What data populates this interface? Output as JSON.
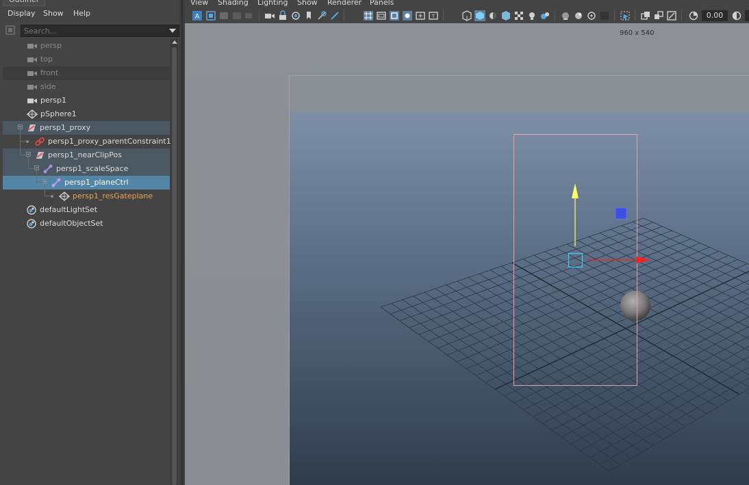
{
  "outliner": {
    "title": "Outliner",
    "menus": [
      "Display",
      "Show",
      "Help"
    ],
    "search_placeholder": "Search...",
    "items": [
      {
        "label": "persp",
        "icon": "camera-icon",
        "depth": 0,
        "state": "dimmed"
      },
      {
        "label": "top",
        "icon": "camera-icon",
        "depth": 0,
        "state": "dimmed"
      },
      {
        "label": "front",
        "icon": "camera-icon",
        "depth": 0,
        "state": "dimmed"
      },
      {
        "label": "side",
        "icon": "camera-icon",
        "depth": 0,
        "state": "dimmed"
      },
      {
        "label": "persp1",
        "icon": "camera-icon",
        "depth": 0,
        "state": "normal"
      },
      {
        "label": "pSphere1",
        "icon": "mesh-icon",
        "depth": 0,
        "state": "normal"
      },
      {
        "label": "persp1_proxy",
        "icon": "proxy-icon",
        "depth": 0,
        "state": "highlight"
      },
      {
        "label": "persp1_proxy_parentConstraint1",
        "icon": "constraint-icon",
        "depth": 1,
        "state": "normal"
      },
      {
        "label": "persp1_nearClipPos",
        "icon": "proxy-icon",
        "depth": 1,
        "state": "highlight"
      },
      {
        "label": "persp1_scaleSpace",
        "icon": "locator-icon",
        "depth": 2,
        "state": "highlight"
      },
      {
        "label": "persp1_planeCtrl",
        "icon": "locator-icon",
        "depth": 3,
        "state": "selected"
      },
      {
        "label": "persp1_resGateplane",
        "icon": "mesh-icon",
        "depth": 4,
        "state": "orange"
      },
      {
        "label": "defaultLightSet",
        "icon": "set-icon",
        "depth": 0,
        "state": "normal"
      },
      {
        "label": "defaultObjectSet",
        "icon": "set-icon",
        "depth": 0,
        "state": "normal"
      }
    ]
  },
  "viewport": {
    "menus": [
      "View",
      "Shading",
      "Lighting",
      "Show",
      "Renderer",
      "Panels"
    ],
    "exposure_value": "0.00",
    "resolution_label": "960 x 540",
    "toolbar_icons": [
      "camera-select-icon",
      "camera-attributes-icon",
      "bookmarks-icon",
      "image-plane-icon",
      "film-gate-icon",
      "resolution-gate-icon",
      "grid-icon",
      "wireframe-icon",
      "smooth-shade-icon",
      "lighting-icon",
      "isolate-icon",
      "xray-icon",
      "exposure-icon",
      "gamma-icon"
    ],
    "colors": {
      "selected_row": "#5285a6",
      "highlight_row": "#4b5862",
      "orange_text": "#e8a25a",
      "gate_border": "#e6a1ad",
      "y_axis": "#ffff66",
      "x_axis": "#ff1e1e",
      "z_handle": "#3a50e0",
      "center_handle": "#3fd0ee"
    }
  }
}
